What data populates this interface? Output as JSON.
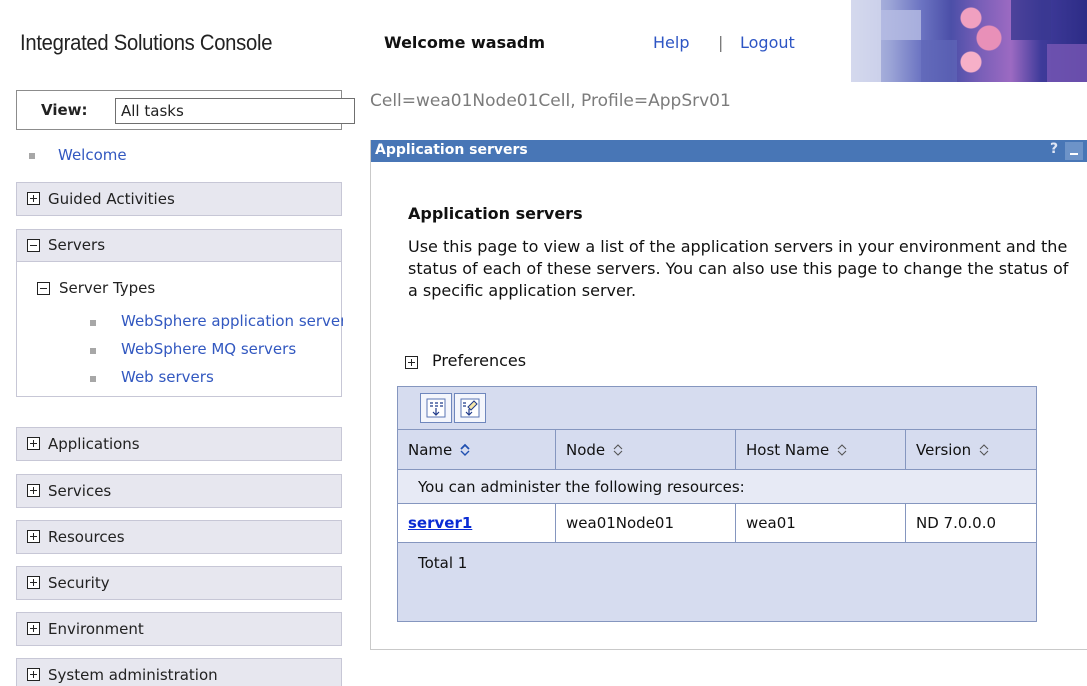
{
  "banner": {
    "console_title": "Integrated Solutions Console",
    "welcome": "Welcome wasadm",
    "help": "Help",
    "separator": "|",
    "logout": "Logout"
  },
  "nav": {
    "view_label": "View:",
    "view_value": "All tasks",
    "welcome": "Welcome",
    "categories": {
      "guided": "Guided Activities",
      "servers": "Servers",
      "applications": "Applications",
      "services": "Services",
      "resources": "Resources",
      "security": "Security",
      "environment": "Environment",
      "system_admin": "System administration"
    },
    "server_types": {
      "label": "Server Types",
      "items": [
        "WebSphere application servers",
        "WebSphere MQ servers",
        "Web servers"
      ]
    }
  },
  "main": {
    "breadcrumb": "Cell=wea01Node01Cell, Profile=AppSrv01",
    "portlet_title": "Application servers",
    "help_icon": "?",
    "page_title": "Application servers",
    "description": "Use this page to view a list of the application servers in your environment and the status of each of these servers. You can also use this page to change the status of a specific application server.",
    "preferences": "Preferences",
    "table": {
      "columns": [
        "Name",
        "Node",
        "Host Name",
        "Version"
      ],
      "message": "You can administer the following resources:",
      "rows": [
        {
          "name": "server1",
          "node": "wea01Node01",
          "host": "wea01",
          "version": "ND 7.0.0.0"
        }
      ],
      "total": "Total 1"
    }
  },
  "icons": [
    "plus-box-icon",
    "minus-box-icon",
    "select-all-icon",
    "deselect-all-icon",
    "sort-icon",
    "help-icon",
    "minimize-icon"
  ],
  "colors": {
    "portlet_title_bg": "#4876b6",
    "link": "#3258c0",
    "nav_category_bg": "#e7e7ef",
    "table_bg": "#d6dcef"
  }
}
